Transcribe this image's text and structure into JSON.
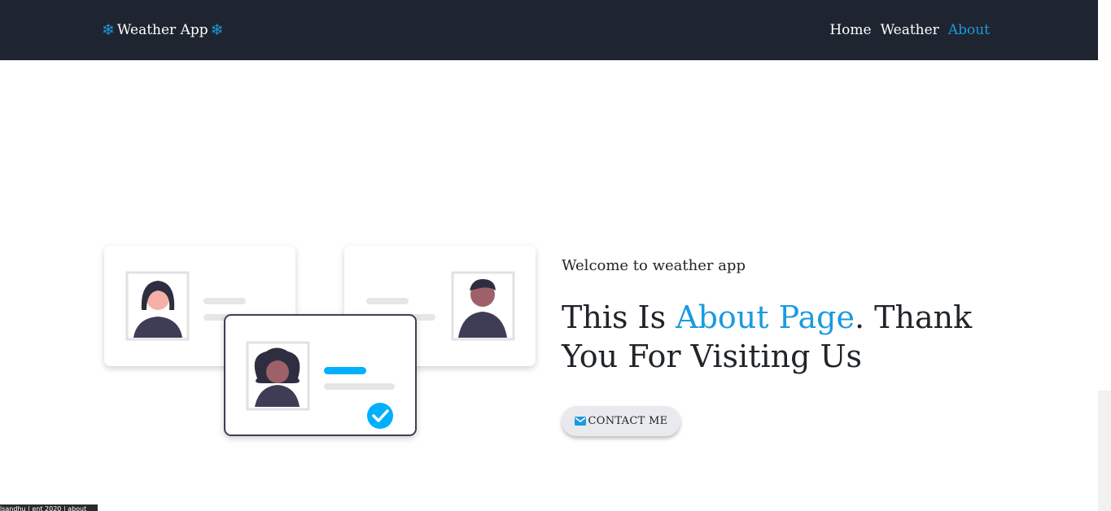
{
  "navbar": {
    "brand_label": "Weather App",
    "brand_icon": "snowflake-icon",
    "links": [
      {
        "label": "Home"
      },
      {
        "label": "Weather"
      },
      {
        "label": "About",
        "active": true
      }
    ]
  },
  "main": {
    "welcome_text": "Welcome to weather app",
    "headline_prefix": "This Is ",
    "headline_accent": "About Page",
    "headline_suffix": ". Thank You For Visiting Us",
    "contact_button_label": "CONTACT ME"
  },
  "footer": {
    "strip_text": "lsandhu | ent 2020 | about"
  },
  "colors": {
    "navbar_bg": "#1f2530",
    "accent": "#1a9ae0",
    "text": "#212529",
    "button_bg": "#e9eaed"
  }
}
